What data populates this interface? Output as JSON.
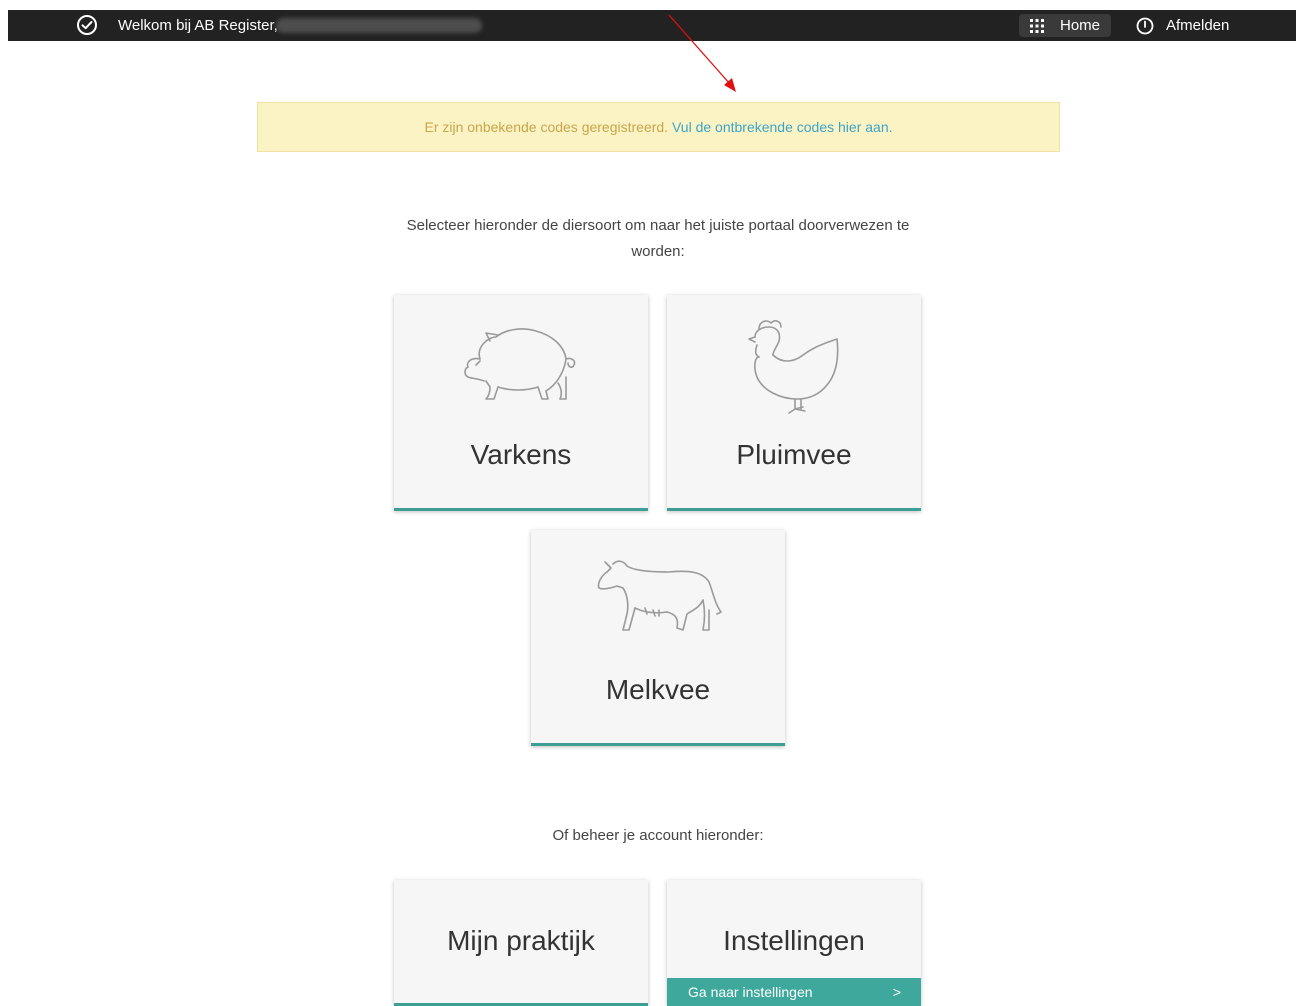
{
  "topbar": {
    "welcome": "Welkom bij AB Register,",
    "home_label": "Home",
    "logout_label": "Afmelden"
  },
  "notice": {
    "text": "Er zijn onbekende codes geregistreerd.",
    "link": "Vul de ontbrekende codes hier aan."
  },
  "intro": "Selecteer hieronder de diersoort om naar het juiste portaal doorverwezen te worden:",
  "tiles": [
    {
      "label": "Varkens",
      "icon": "pig-icon"
    },
    {
      "label": "Pluimvee",
      "icon": "chicken-icon"
    },
    {
      "label": "Melkvee",
      "icon": "cow-icon"
    }
  ],
  "account_heading": "Of beheer je account hieronder:",
  "account_tiles": [
    {
      "label": "Mijn praktijk"
    },
    {
      "label": "Instellingen",
      "link": "Ga naar instellingen",
      "chevron": ">"
    }
  ],
  "colors": {
    "topbar": "#222222",
    "notice_bg": "#fcf3c4",
    "notice_text": "#c7a64c",
    "link": "#3aa5c9",
    "accent": "#3e9e94",
    "annotation": "#e01010"
  }
}
